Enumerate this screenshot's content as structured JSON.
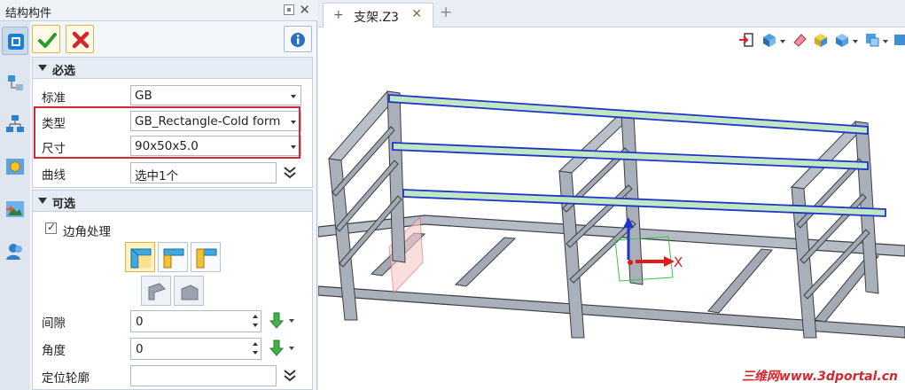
{
  "panel": {
    "title": "结构构件",
    "close_glyph": "✕"
  },
  "side_tabs": [
    "structure-member-icon",
    "tree-icon",
    "hierarchy-icon",
    "part-cube-icon",
    "import-image-icon",
    "user-icon"
  ],
  "required": {
    "header": "必选",
    "standard": {
      "label": "标准",
      "value": "GB"
    },
    "type": {
      "label": "类型",
      "value": "GB_Rectangle-Cold form"
    },
    "size": {
      "label": "尺寸",
      "value": "90x50x5.0"
    },
    "curve": {
      "label": "曲线",
      "value": "选中1个"
    }
  },
  "optional": {
    "header": "可选",
    "corner_treatment": {
      "label": "边角处理",
      "checked": true
    },
    "gap": {
      "label": "间隙",
      "value": "0"
    },
    "angle": {
      "label": "角度",
      "value": "0"
    },
    "locate_profile": {
      "label": "定位轮廓",
      "value": ""
    }
  },
  "document_tab": {
    "icon": "+",
    "name": "支架.Z3",
    "close": "✕",
    "new_tab": "+"
  },
  "viewport": {
    "axis_label": "X",
    "watermark": "三维网www.3dportal.cn"
  },
  "colors": {
    "accent": "#e0b44a",
    "highlight_box": "#d8262e",
    "frame_gray": "#a9b0b9",
    "beam_blue": "#1f35c9",
    "beam_green": "#bfe8c2"
  }
}
